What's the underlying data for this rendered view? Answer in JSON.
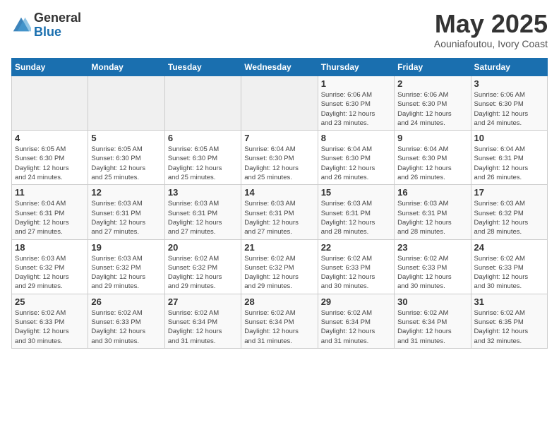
{
  "logo": {
    "general": "General",
    "blue": "Blue"
  },
  "header": {
    "month": "May 2025",
    "location": "Aouniafoutou, Ivory Coast"
  },
  "weekdays": [
    "Sunday",
    "Monday",
    "Tuesday",
    "Wednesday",
    "Thursday",
    "Friday",
    "Saturday"
  ],
  "weeks": [
    [
      {
        "day": "",
        "info": ""
      },
      {
        "day": "",
        "info": ""
      },
      {
        "day": "",
        "info": ""
      },
      {
        "day": "",
        "info": ""
      },
      {
        "day": "1",
        "info": "Sunrise: 6:06 AM\nSunset: 6:30 PM\nDaylight: 12 hours\nand 23 minutes."
      },
      {
        "day": "2",
        "info": "Sunrise: 6:06 AM\nSunset: 6:30 PM\nDaylight: 12 hours\nand 24 minutes."
      },
      {
        "day": "3",
        "info": "Sunrise: 6:06 AM\nSunset: 6:30 PM\nDaylight: 12 hours\nand 24 minutes."
      }
    ],
    [
      {
        "day": "4",
        "info": "Sunrise: 6:05 AM\nSunset: 6:30 PM\nDaylight: 12 hours\nand 24 minutes."
      },
      {
        "day": "5",
        "info": "Sunrise: 6:05 AM\nSunset: 6:30 PM\nDaylight: 12 hours\nand 25 minutes."
      },
      {
        "day": "6",
        "info": "Sunrise: 6:05 AM\nSunset: 6:30 PM\nDaylight: 12 hours\nand 25 minutes."
      },
      {
        "day": "7",
        "info": "Sunrise: 6:04 AM\nSunset: 6:30 PM\nDaylight: 12 hours\nand 25 minutes."
      },
      {
        "day": "8",
        "info": "Sunrise: 6:04 AM\nSunset: 6:30 PM\nDaylight: 12 hours\nand 26 minutes."
      },
      {
        "day": "9",
        "info": "Sunrise: 6:04 AM\nSunset: 6:30 PM\nDaylight: 12 hours\nand 26 minutes."
      },
      {
        "day": "10",
        "info": "Sunrise: 6:04 AM\nSunset: 6:31 PM\nDaylight: 12 hours\nand 26 minutes."
      }
    ],
    [
      {
        "day": "11",
        "info": "Sunrise: 6:04 AM\nSunset: 6:31 PM\nDaylight: 12 hours\nand 27 minutes."
      },
      {
        "day": "12",
        "info": "Sunrise: 6:03 AM\nSunset: 6:31 PM\nDaylight: 12 hours\nand 27 minutes."
      },
      {
        "day": "13",
        "info": "Sunrise: 6:03 AM\nSunset: 6:31 PM\nDaylight: 12 hours\nand 27 minutes."
      },
      {
        "day": "14",
        "info": "Sunrise: 6:03 AM\nSunset: 6:31 PM\nDaylight: 12 hours\nand 27 minutes."
      },
      {
        "day": "15",
        "info": "Sunrise: 6:03 AM\nSunset: 6:31 PM\nDaylight: 12 hours\nand 28 minutes."
      },
      {
        "day": "16",
        "info": "Sunrise: 6:03 AM\nSunset: 6:31 PM\nDaylight: 12 hours\nand 28 minutes."
      },
      {
        "day": "17",
        "info": "Sunrise: 6:03 AM\nSunset: 6:32 PM\nDaylight: 12 hours\nand 28 minutes."
      }
    ],
    [
      {
        "day": "18",
        "info": "Sunrise: 6:03 AM\nSunset: 6:32 PM\nDaylight: 12 hours\nand 29 minutes."
      },
      {
        "day": "19",
        "info": "Sunrise: 6:03 AM\nSunset: 6:32 PM\nDaylight: 12 hours\nand 29 minutes."
      },
      {
        "day": "20",
        "info": "Sunrise: 6:02 AM\nSunset: 6:32 PM\nDaylight: 12 hours\nand 29 minutes."
      },
      {
        "day": "21",
        "info": "Sunrise: 6:02 AM\nSunset: 6:32 PM\nDaylight: 12 hours\nand 29 minutes."
      },
      {
        "day": "22",
        "info": "Sunrise: 6:02 AM\nSunset: 6:33 PM\nDaylight: 12 hours\nand 30 minutes."
      },
      {
        "day": "23",
        "info": "Sunrise: 6:02 AM\nSunset: 6:33 PM\nDaylight: 12 hours\nand 30 minutes."
      },
      {
        "day": "24",
        "info": "Sunrise: 6:02 AM\nSunset: 6:33 PM\nDaylight: 12 hours\nand 30 minutes."
      }
    ],
    [
      {
        "day": "25",
        "info": "Sunrise: 6:02 AM\nSunset: 6:33 PM\nDaylight: 12 hours\nand 30 minutes."
      },
      {
        "day": "26",
        "info": "Sunrise: 6:02 AM\nSunset: 6:33 PM\nDaylight: 12 hours\nand 30 minutes."
      },
      {
        "day": "27",
        "info": "Sunrise: 6:02 AM\nSunset: 6:34 PM\nDaylight: 12 hours\nand 31 minutes."
      },
      {
        "day": "28",
        "info": "Sunrise: 6:02 AM\nSunset: 6:34 PM\nDaylight: 12 hours\nand 31 minutes."
      },
      {
        "day": "29",
        "info": "Sunrise: 6:02 AM\nSunset: 6:34 PM\nDaylight: 12 hours\nand 31 minutes."
      },
      {
        "day": "30",
        "info": "Sunrise: 6:02 AM\nSunset: 6:34 PM\nDaylight: 12 hours\nand 31 minutes."
      },
      {
        "day": "31",
        "info": "Sunrise: 6:02 AM\nSunset: 6:35 PM\nDaylight: 12 hours\nand 32 minutes."
      }
    ]
  ]
}
